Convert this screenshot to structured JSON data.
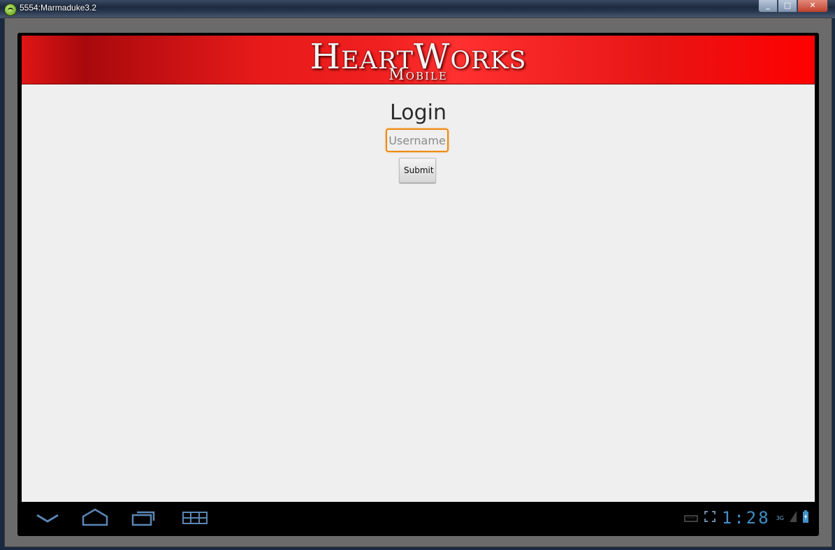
{
  "window": {
    "title": "5554:Marmaduke3.2",
    "controls": {
      "minimize": "_",
      "maximize": "□",
      "close": "✕"
    }
  },
  "header": {
    "logo_main": "HeartWorks",
    "logo_sub": "Mobile"
  },
  "login": {
    "title": "Login",
    "username_placeholder": "Username",
    "username_value": "",
    "submit_label": "Submit"
  },
  "system_bar": {
    "icons": [
      "back-icon",
      "home-icon",
      "recent-apps-icon",
      "menu-icon",
      "keyboard-icon",
      "fullscreen-icon",
      "signal-icon",
      "battery-icon"
    ],
    "clock": "1:28",
    "network": "3G",
    "accent_color": "#3f8fc7"
  },
  "colors": {
    "header_red": "#e81a1a",
    "focus_orange": "#f08a10",
    "background": "#efefef"
  }
}
